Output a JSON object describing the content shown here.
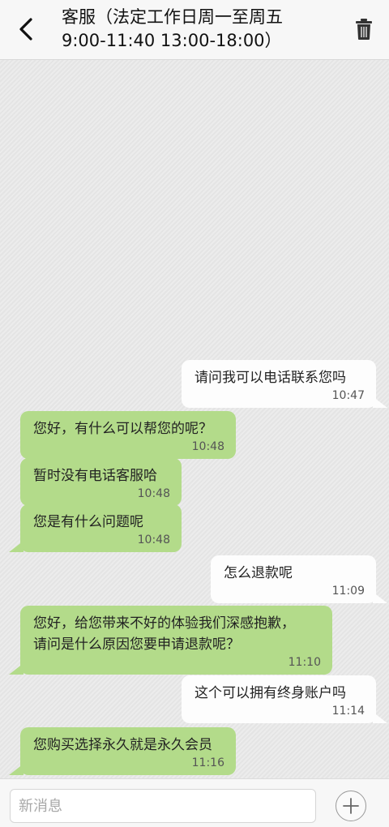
{
  "header": {
    "title_line1": "客服（法定工作日周一至周五",
    "title_line2": "9:00-11:40 13:00-18:00）",
    "back_icon": "chevron-left-icon",
    "trash_icon": "trash-icon"
  },
  "messages": [
    {
      "side": "out",
      "lines": [
        "请问我可以电话联系您吗"
      ],
      "time": "10:47"
    },
    {
      "side": "in",
      "lines": [
        "您好，有什么可以帮您的呢？"
      ],
      "time": "10:48"
    },
    {
      "side": "in",
      "lines": [
        "暂时没有电话客服哈"
      ],
      "time": "10:48"
    },
    {
      "side": "in",
      "lines": [
        "您是有什么问题呢"
      ],
      "time": "10:48"
    },
    {
      "side": "out",
      "lines": [
        "怎么退款呢"
      ],
      "time": "11:09"
    },
    {
      "side": "in",
      "lines": [
        "您好，给您带来不好的体验我们深感抱歉，",
        "请问是什么原因您要申请退款呢？"
      ],
      "time": "11:10"
    },
    {
      "side": "out",
      "lines": [
        "这个可以拥有终身账户吗"
      ],
      "time": "11:14"
    },
    {
      "side": "in",
      "lines": [
        "您购买选择永久就是永久会员"
      ],
      "time": "11:16"
    }
  ],
  "composer": {
    "placeholder": "新消息",
    "add_icon": "plus-icon"
  },
  "colors": {
    "incoming_bubble": "#b3db8a",
    "outgoing_bubble": "#fdfdfd",
    "header_bg": "#f7f7f7"
  }
}
